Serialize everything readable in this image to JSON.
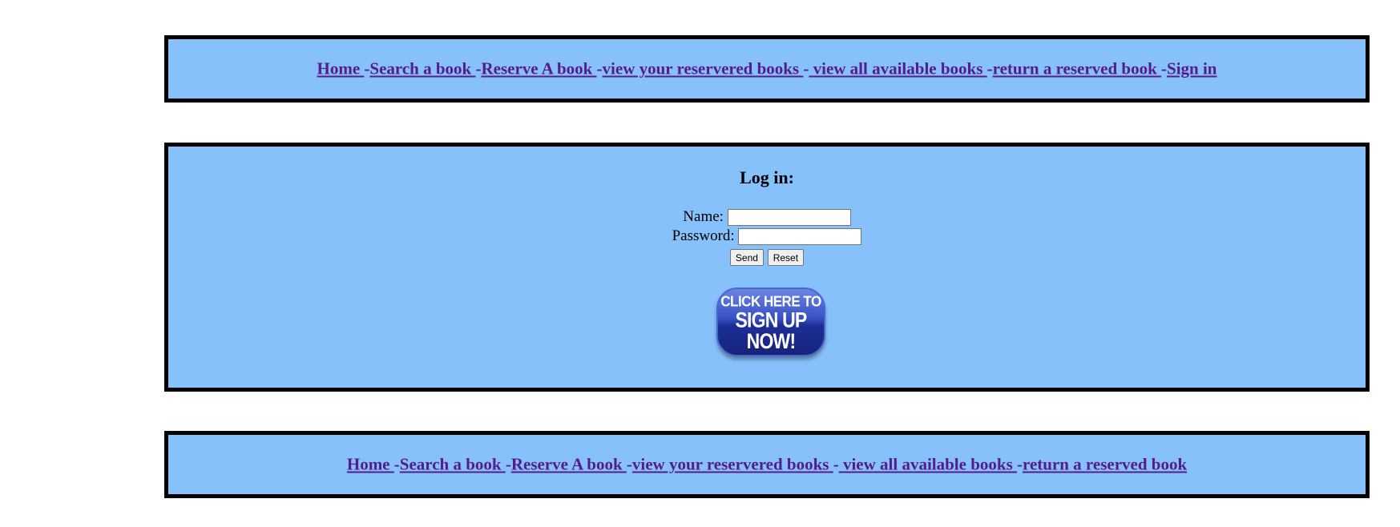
{
  "top_nav": {
    "items": [
      {
        "label": "Home "
      },
      {
        "label": "Search a book "
      },
      {
        "label": "Reserve A book "
      },
      {
        "label": "view your reservered books "
      },
      {
        "label": " view all available books "
      },
      {
        "label": "return a reserved book "
      },
      {
        "label": "Sign in"
      }
    ],
    "separator": "-"
  },
  "login": {
    "title": "Log in:",
    "name_label": "Name:",
    "name_value": "",
    "password_label": "Password:",
    "password_value": "",
    "send_label": "Send",
    "reset_label": "Reset",
    "signup_line1": "CLICK HERE TO",
    "signup_line2": "SIGN UP NOW!"
  },
  "bottom_nav": {
    "items": [
      {
        "label": "Home "
      },
      {
        "label": "Search a book "
      },
      {
        "label": "Reserve A book "
      },
      {
        "label": "view your reservered books "
      },
      {
        "label": " view all available books "
      },
      {
        "label": "return a reserved book"
      }
    ],
    "separator": "-"
  },
  "colors": {
    "panel_bg": "#87c1fc",
    "link": "#551a8b",
    "border": "#000000"
  }
}
